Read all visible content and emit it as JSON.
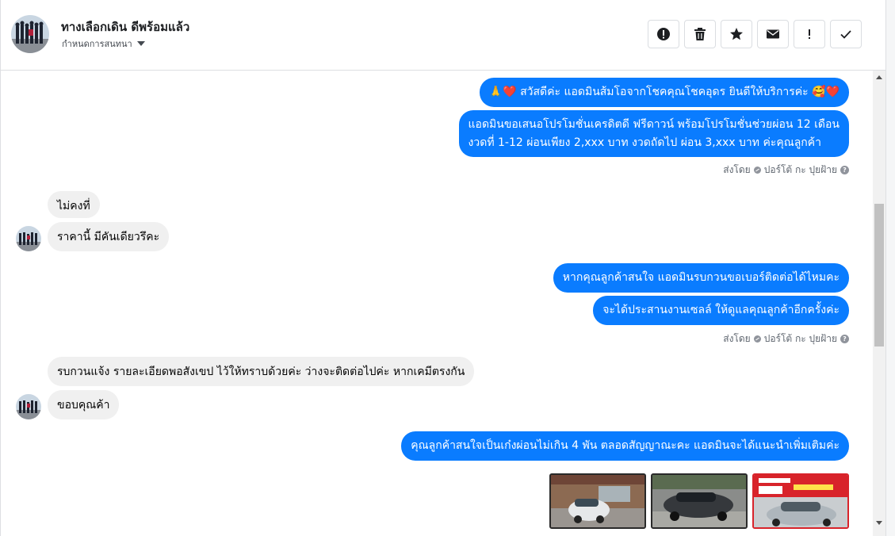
{
  "header": {
    "title": "ทางเลือกเดิน ดีพร้อมแล้ว",
    "subtitle": "กำหนดการสนทนา",
    "actions": [
      {
        "icon": "alert-circle-icon",
        "name": "mark-spam-button"
      },
      {
        "icon": "trash-icon",
        "name": "delete-button"
      },
      {
        "icon": "star-icon",
        "name": "star-button"
      },
      {
        "icon": "envelope-icon",
        "name": "mark-unread-button"
      },
      {
        "icon": "exclamation-icon",
        "name": "follow-up-button"
      },
      {
        "icon": "checkmark-icon",
        "name": "mark-done-button"
      }
    ]
  },
  "messages": {
    "m1": "🙏❤️ สวัสดีค่ะ แอดมินส้มโอจากโชคคุณโชคอุดร ยินดีให้บริการค่ะ 🥰❤️",
    "m2_line1": "แอดมินขอเสนอโปรโมชั่นเครดิตดี ฟรีดาวน์ พร้อมโปรโมชั่นช่วยผ่อน 12 เดือน",
    "m2_line2": "งวดที่ 1-12 ผ่อนเพียง 2,xxx บาท งวดถัดไป ผ่อน 3,xxx บาท ค่ะคุณลูกค้า",
    "sent_by_1_label": "ส่งโดย",
    "sent_by_1_name": "ปอร์โต้ กะ ปุยฝ้าย",
    "in1": "ไม่คงที่",
    "in2": "ราคานี้ มีคันเดียวรึคะ",
    "m3": "หากคุณลูกค้าสนใจ แอดมินรบกวนขอเบอร์ติดต่อได้ไหมคะ",
    "m4": "จะได้ประสานงานเซลล์ ให้ดูแลคุณลูกค้าอีกครั้งค่ะ",
    "sent_by_2_label": "ส่งโดย",
    "sent_by_2_name": "ปอร์โต้ กะ ปุยฝ้าย",
    "in3": "รบกวนแจ้ง รายละเอียดพอสังเขป ไว้ให้ทราบด้วยค่ะ ว่างจะติดต่อไปค่ะ หากเคมีตรงกัน",
    "in4": "ขอบคุณค้า",
    "m5": "คุณลูกค้าสนใจเป็นเก๋งผ่อนไม่เกิน 4 พัน ตลอดสัญญาณะคะ แอดมินจะได้แนะนำเพิ่มเติมค่ะ"
  },
  "colors": {
    "outgoing_bubble": "#0a7cff",
    "incoming_bubble": "#f0f0f0",
    "promo_banner": "#d8232a"
  }
}
